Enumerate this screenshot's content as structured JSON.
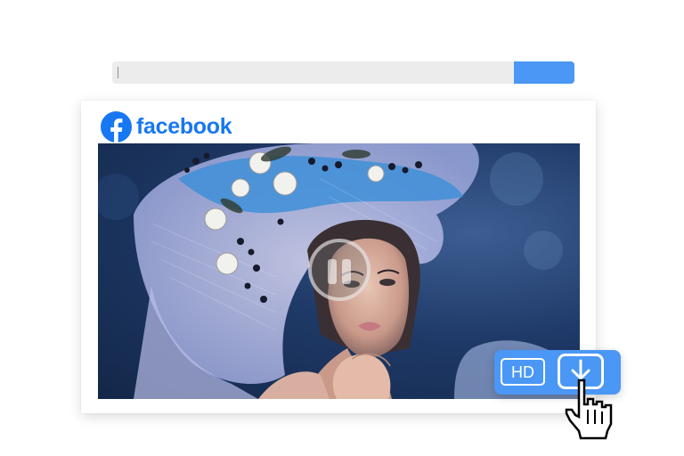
{
  "search": {
    "value": "",
    "placeholder": ""
  },
  "card": {
    "brand": "facebook"
  },
  "player": {
    "state": "paused",
    "control_icon": "pause-icon"
  },
  "download": {
    "quality_label": "HD",
    "icon": "download-icon"
  },
  "colors": {
    "accent": "#4a97f5",
    "facebook_blue": "#1877f2",
    "url_bar": "#ececec"
  }
}
